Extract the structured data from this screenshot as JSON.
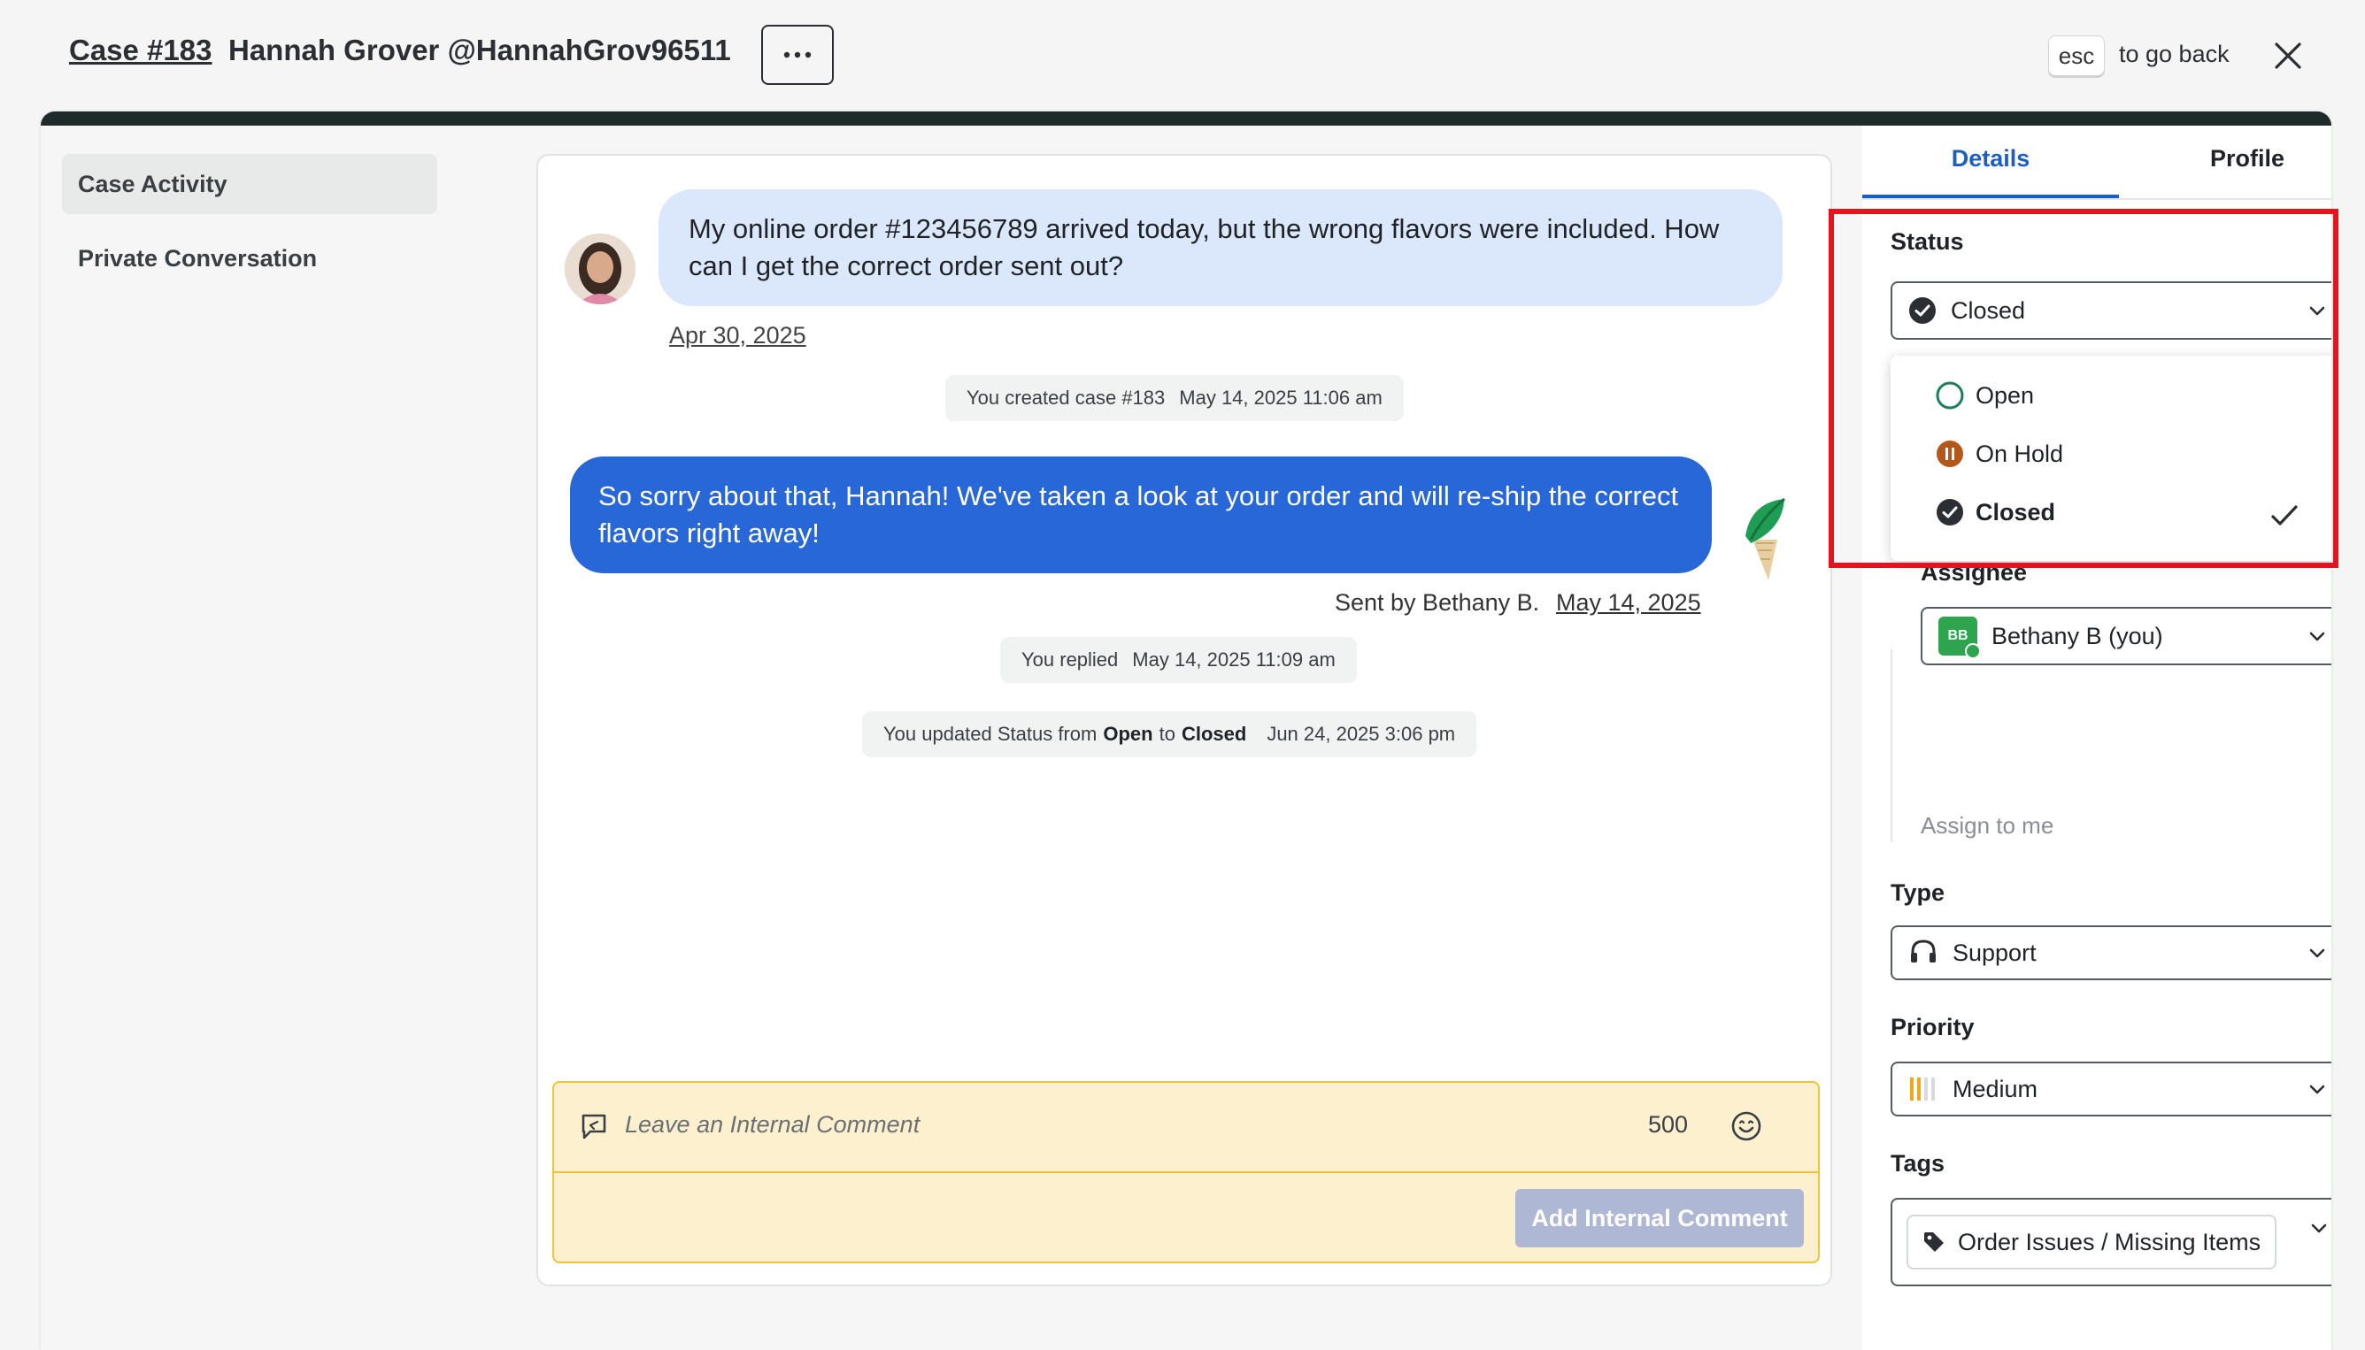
{
  "header": {
    "case_link": "Case #183",
    "customer": "Hannah Grover @HannahGrov96511",
    "esc_key": "esc",
    "esc_hint": "to go back"
  },
  "nav": {
    "items": [
      {
        "label": "Case Activity",
        "active": true
      },
      {
        "label": "Private Conversation",
        "active": false
      }
    ]
  },
  "conversation": {
    "incoming": {
      "text": "My online order #123456789 arrived today, but the wrong flavors were included. How can I get the correct order sent out?",
      "date": "Apr 30, 2025"
    },
    "system_created": {
      "text": "You created case #183",
      "time": "May 14, 2025 11:06 am"
    },
    "outgoing": {
      "text": "So sorry about that, Hannah! We've taken a look at your order and will re-ship the correct flavors right away!",
      "sent_by": "Sent by Bethany B.",
      "date": "May 14, 2025"
    },
    "system_replied": {
      "text": "You replied",
      "time": "May 14, 2025 11:09 am"
    },
    "system_status": {
      "prefix": "You updated Status from",
      "from": "Open",
      "mid": "to",
      "to": "Closed",
      "time": "Jun 24, 2025 3:06 pm"
    }
  },
  "comment": {
    "placeholder": "Leave an Internal Comment",
    "char_count": "500",
    "button": "Add Internal Comment"
  },
  "panel": {
    "tabs": {
      "details": "Details",
      "profile": "Profile"
    },
    "status": {
      "label": "Status",
      "value": "Closed",
      "options": [
        {
          "label": "Open",
          "color": "#1a7f5a"
        },
        {
          "label": "On Hold",
          "color": "#b5561b"
        },
        {
          "label": "Closed",
          "color": "#2b2f33",
          "selected": true
        }
      ]
    },
    "assignee": {
      "label": "Assignee",
      "initials": "BB",
      "value": "Bethany B (you)",
      "assign_link": "Assign to me"
    },
    "type": {
      "label": "Type",
      "value": "Support"
    },
    "priority": {
      "label": "Priority",
      "value": "Medium"
    },
    "tags": {
      "label": "Tags",
      "items": [
        "Order Issues / Missing Items"
      ]
    }
  },
  "colors": {
    "accent_blue": "#2767d8",
    "tab_active": "#1d5fbf",
    "highlight_red": "#e3141e",
    "comment_bg": "#fdf0cf",
    "comment_border": "#f0c33c"
  }
}
